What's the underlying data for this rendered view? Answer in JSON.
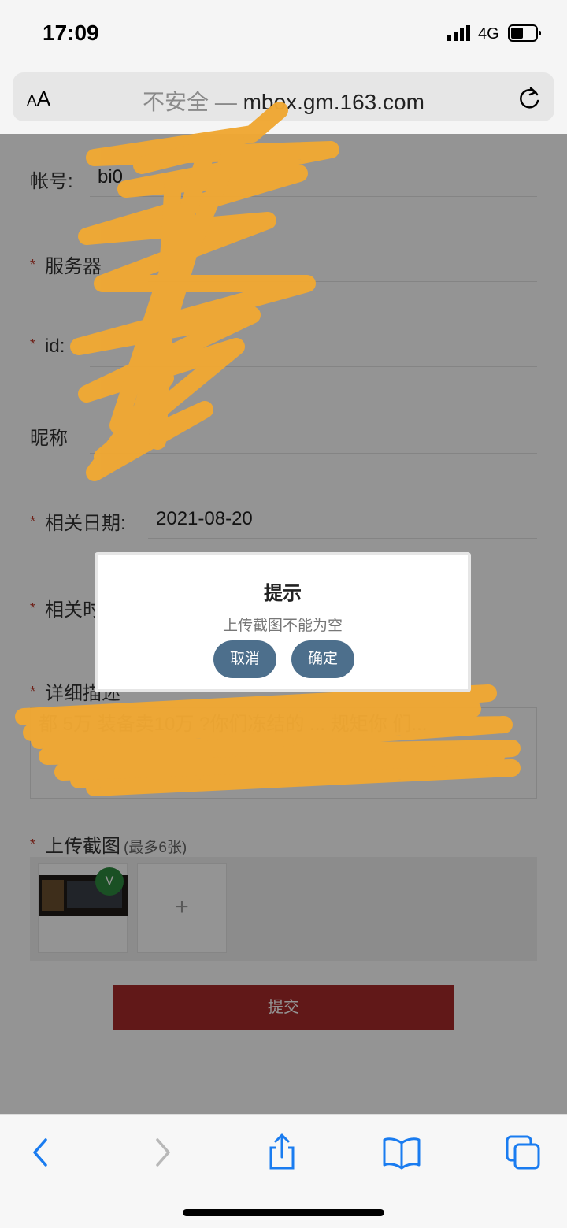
{
  "status_bar": {
    "time": "17:09",
    "network": "4G"
  },
  "browser": {
    "text_size_button": "AA",
    "url_insecure": "不安全 —",
    "url_domain": "mbox.gm.163.com",
    "reload_icon": "reload-icon"
  },
  "form": {
    "account_label": "帐号:",
    "account_value": "bi0",
    "server_label": "服务器",
    "id_label": "id:",
    "nickname_label": "昵称",
    "date_label": "相关日期:",
    "date_value": "2021-08-20",
    "time_label": "相关时",
    "detail_label": "详细描述",
    "detail_text": "都   5万   装备卖10万   ?你们冻结的 ...                         规矩你 们...",
    "upload_label": "上传截图",
    "upload_hint": "(最多6张)",
    "check_badge": "V",
    "add_icon": "+",
    "submit_label": "提交"
  },
  "dialog": {
    "title": "提示",
    "message": "上传截图不能为空",
    "cancel_label": "取消",
    "confirm_label": "确定"
  },
  "toolbar": {
    "back_icon": "back-icon",
    "forward_icon": "forward-icon",
    "share_icon": "share-icon",
    "bookmarks_icon": "bookmarks-icon",
    "tabs_icon": "tabs-icon"
  },
  "colors": {
    "accent_blue": "#4d6f8c",
    "submit_red": "#a82a2a",
    "scribble": "#f0a833",
    "required_star": "#c0392b"
  }
}
